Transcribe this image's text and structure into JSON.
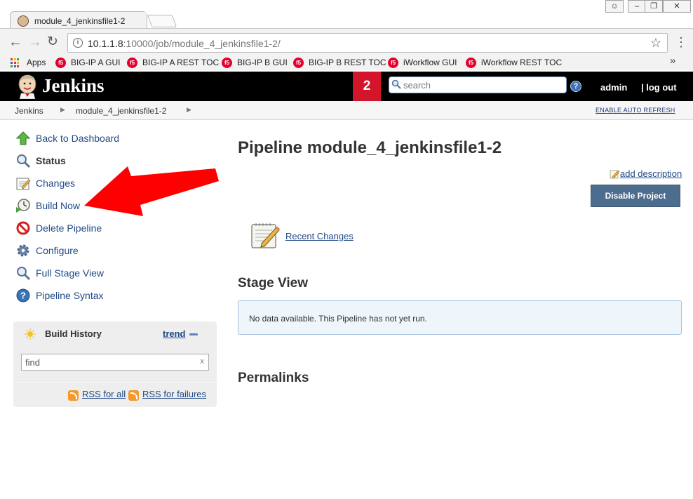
{
  "browser": {
    "tab_title": "module_4_jenkinsfile1-2",
    "url_host": "10.1.1.8",
    "url_path": ":10000/job/module_4_jenkinsfile1-2/",
    "window_controls": [
      "minimize-icon",
      "maximize-icon",
      "close-icon"
    ],
    "bookmarks": [
      {
        "label": "Apps",
        "icon": "apps-icon"
      },
      {
        "label": "BIG-IP A GUI",
        "icon": "f5-icon"
      },
      {
        "label": "BIG-IP A REST TOC",
        "icon": "f5-icon"
      },
      {
        "label": "BIG-IP B GUI",
        "icon": "f5-icon"
      },
      {
        "label": "BIG-IP B REST TOC",
        "icon": "f5-icon"
      },
      {
        "label": "iWorkflow GUI",
        "icon": "f5-icon"
      },
      {
        "label": "iWorkflow REST TOC",
        "icon": "f5-icon"
      }
    ],
    "more": "»"
  },
  "header": {
    "brand": "Jenkins",
    "notification_count": "2",
    "search_placeholder": "search",
    "user": "admin",
    "logout": "| log out",
    "colors": {
      "bar": "#000000",
      "notification": "#d2152b"
    }
  },
  "breadcrumb": {
    "items": [
      "Jenkins",
      "module_4_jenkinsfile1-2"
    ],
    "auto_refresh": "ENABLE AUTO REFRESH"
  },
  "sidebar": {
    "tasks": [
      {
        "label": "Back to Dashboard",
        "icon": "up-arrow-icon"
      },
      {
        "label": "Status",
        "icon": "magnifier-icon",
        "active": true
      },
      {
        "label": "Changes",
        "icon": "notepad-icon"
      },
      {
        "label": "Build Now",
        "icon": "clock-icon"
      },
      {
        "label": "Delete Pipeline",
        "icon": "no-entry-icon"
      },
      {
        "label": "Configure",
        "icon": "gear-icon"
      },
      {
        "label": "Full Stage View",
        "icon": "magnifier-icon"
      },
      {
        "label": "Pipeline Syntax",
        "icon": "help-icon"
      }
    ],
    "build_history": {
      "title": "Build History",
      "trend": "trend",
      "find_placeholder": "find",
      "clear": "x",
      "rss_all": "RSS for all",
      "rss_failures": "RSS for failures"
    }
  },
  "main": {
    "title": "Pipeline module_4_jenkinsfile1-2",
    "add_description": "add description",
    "disable_button": "Disable Project",
    "recent_changes": "Recent Changes",
    "stage_view_heading": "Stage View",
    "no_data_message": "No data available. This Pipeline has not yet run.",
    "permalinks_heading": "Permalinks"
  },
  "annotation": {
    "type": "arrow",
    "color": "#ff0000",
    "points_to": "Build Now"
  }
}
